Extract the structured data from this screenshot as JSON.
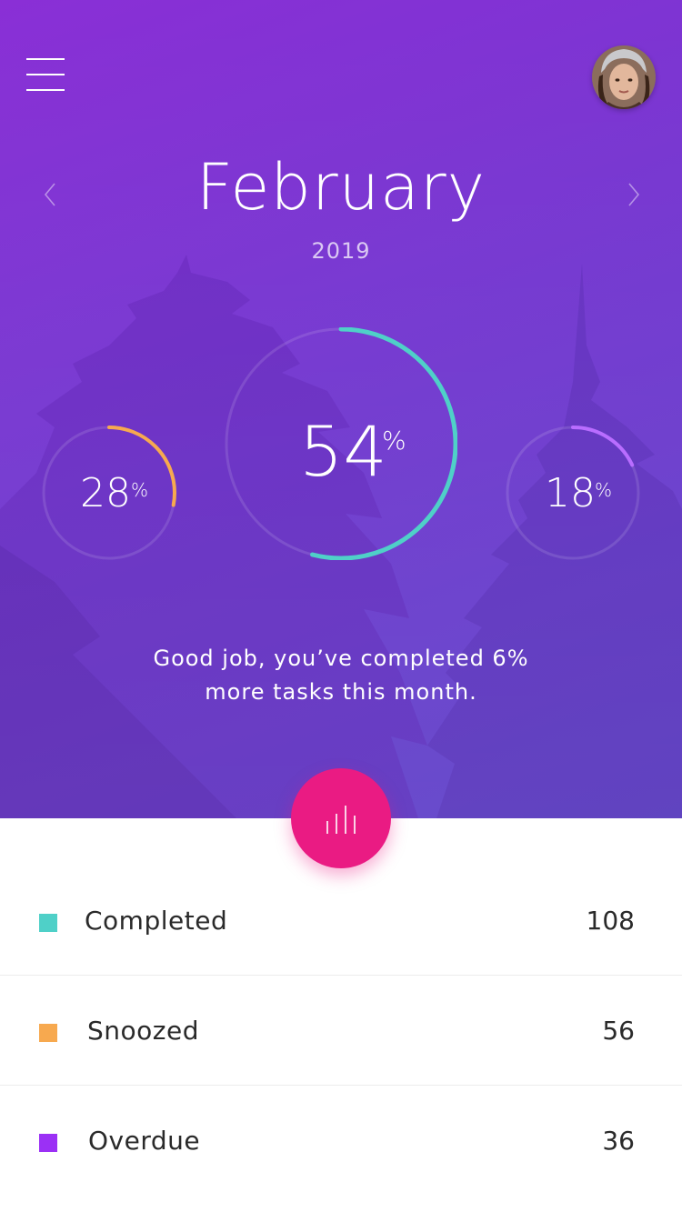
{
  "header": {
    "month": "February",
    "year": "2019",
    "menu_icon": "hamburger-menu-icon",
    "avatar_icon": "user-avatar",
    "prev_icon": "chevron-left-icon",
    "next_icon": "chevron-right-icon"
  },
  "rings": {
    "left": {
      "value": "28",
      "unit": "%",
      "fraction": 0.28,
      "color": "#f7a94f"
    },
    "center": {
      "value": "54",
      "unit": "%",
      "fraction": 0.54,
      "color": "#4fd0c8"
    },
    "right": {
      "value": "18",
      "unit": "%",
      "fraction": 0.18,
      "color": "#b96dff"
    }
  },
  "message": {
    "line1": "Good job, you’ve completed 6%",
    "line2": "more tasks this month."
  },
  "fab": {
    "icon": "bar-chart-icon",
    "color": "#ea1b83"
  },
  "stats": [
    {
      "label": "Completed",
      "count": "108",
      "color": "#4fd0c8"
    },
    {
      "label": "Snoozed",
      "count": "56",
      "color": "#f7a94f"
    },
    {
      "label": "Overdue",
      "count": "36",
      "color": "#9b30f5"
    }
  ]
}
